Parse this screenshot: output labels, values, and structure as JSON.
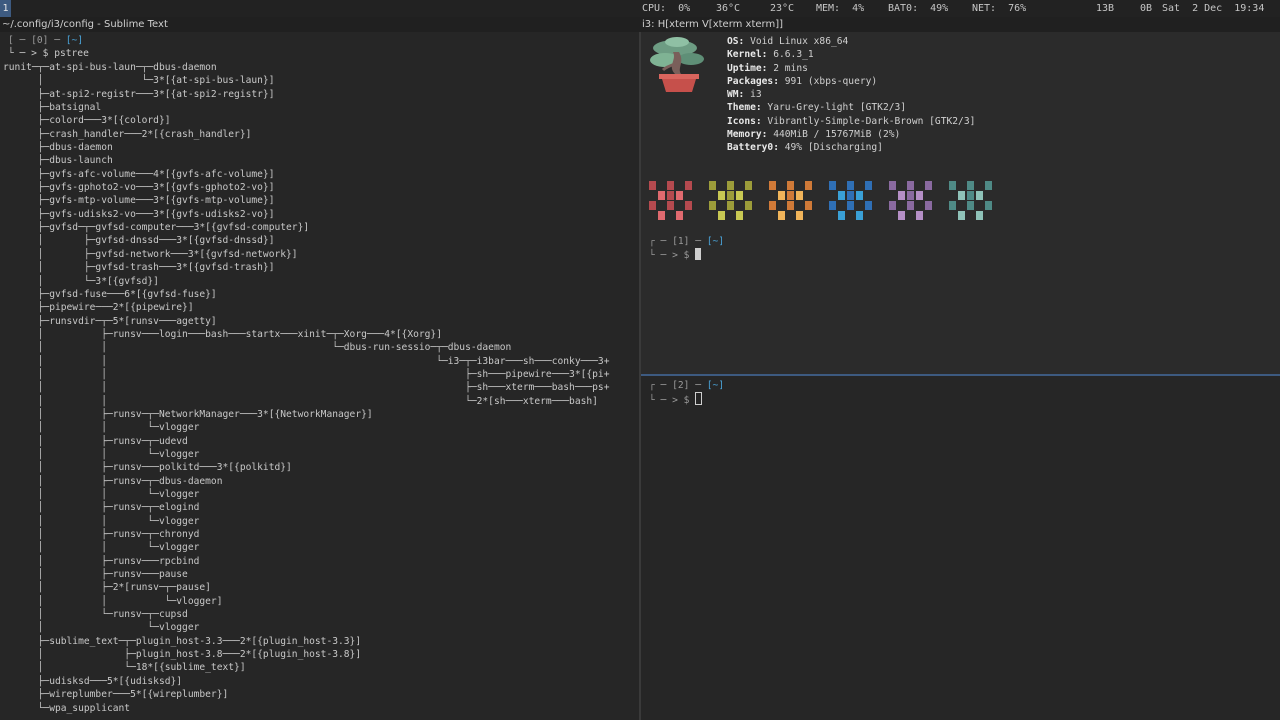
{
  "statusbar": {
    "workspace": "1",
    "items": [
      "CPU:  0%",
      "36°C",
      "23°C",
      "MEM:  4%",
      "BAT0:  49%",
      "NET:  76%",
      "13B",
      "0B",
      "Sat  2 Dec  19:34"
    ]
  },
  "left_window": {
    "title": "~/.config/i3/config - Sublime Text",
    "prompt_top": "[ ─ [0] ─ ",
    "prompt_dir": "[~]",
    "prompt_cmd": "└ ─ > $ pstree",
    "tree": [
      "runit─┬─at-spi-bus-laun─┬─dbus-daemon",
      "      │                 └─3*[{at-spi-bus-laun}]",
      "      ├─at-spi2-registr───3*[{at-spi2-registr}]",
      "      ├─batsignal",
      "      ├─colord───3*[{colord}]",
      "      ├─crash_handler───2*[{crash_handler}]",
      "      ├─dbus-daemon",
      "      ├─dbus-launch",
      "      ├─gvfs-afc-volume───4*[{gvfs-afc-volume}]",
      "      ├─gvfs-gphoto2-vo───3*[{gvfs-gphoto2-vo}]",
      "      ├─gvfs-mtp-volume───3*[{gvfs-mtp-volume}]",
      "      ├─gvfs-udisks2-vo───3*[{gvfs-udisks2-vo}]",
      "      ├─gvfsd─┬─gvfsd-computer───3*[{gvfsd-computer}]",
      "      │       ├─gvfsd-dnssd───3*[{gvfsd-dnssd}]",
      "      │       ├─gvfsd-network───3*[{gvfsd-network}]",
      "      │       ├─gvfsd-trash───3*[{gvfsd-trash}]",
      "      │       └─3*[{gvfsd}]",
      "      ├─gvfsd-fuse───6*[{gvfsd-fuse}]",
      "      ├─pipewire───2*[{pipewire}]",
      "      ├─runsvdir─┬─5*[runsv───agetty]",
      "      │          ├─runsv───login───bash───startx───xinit─┬─Xorg───4*[{Xorg}]",
      "      │          │                                       └─dbus-run-sessio─┬─dbus-daemon",
      "      │          │                                                         └─i3─┬─i3bar───sh───conky───3+",
      "      │          │                                                              ├─sh───pipewire───3*[{pi+",
      "      │          │                                                              ├─sh───xterm───bash───ps+",
      "      │          │                                                              └─2*[sh───xterm───bash]",
      "      │          ├─runsv─┬─NetworkManager───3*[{NetworkManager}]",
      "      │          │       └─vlogger",
      "      │          ├─runsv─┬─udevd",
      "      │          │       └─vlogger",
      "      │          ├─runsv───polkitd───3*[{polkitd}]",
      "      │          ├─runsv─┬─dbus-daemon",
      "      │          │       └─vlogger",
      "      │          ├─runsv─┬─elogind",
      "      │          │       └─vlogger",
      "      │          ├─runsv─┬─chronyd",
      "      │          │       └─vlogger",
      "      │          ├─runsv───rpcbind",
      "      │          ├─runsv───pause",
      "      │          ├─2*[runsv─┬─pause]",
      "      │          │          └─vlogger]",
      "      │          └─runsv─┬─cupsd",
      "      │                  └─vlogger",
      "      ├─sublime_text─┬─plugin_host-3.3───2*[{plugin_host-3.3}]",
      "      │              ├─plugin_host-3.8───2*[{plugin_host-3.8}]",
      "      │              └─18*[{sublime_text}]",
      "      ├─udisksd───5*[{udisksd}]",
      "      ├─wireplumber───5*[{wireplumber}]",
      "      └─wpa_supplicant"
    ]
  },
  "right_window": {
    "title": "i3: H[xterm V[xterm xterm]]",
    "neofetch": [
      {
        "key": "OS:",
        "value": " Void Linux x86_64"
      },
      {
        "key": "Kernel:",
        "value": " 6.6.3_1"
      },
      {
        "key": "Uptime:",
        "value": " 2 mins"
      },
      {
        "key": "Packages:",
        "value": " 991 (xbps-query)"
      },
      {
        "key": "WM:",
        "value": " i3"
      },
      {
        "key": "Theme:",
        "value": " Yaru-Grey-light [GTK2/3]"
      },
      {
        "key": "Icons:",
        "value": " Vibrantly-Simple-Dark-Brown [GTK2/3]"
      },
      {
        "key": "Memory:",
        "value": " 440MiB / 15767MiB (2%)"
      },
      {
        "key": "Battery0:",
        "value": " 49% [Discharging]"
      }
    ],
    "palette": [
      {
        "dark": "#b54a4f",
        "light": "#e06a6f"
      },
      {
        "dark": "#9c9c3a",
        "light": "#c8c853"
      },
      {
        "dark": "#d07a38",
        "light": "#f0b45a"
      },
      {
        "dark": "#2f6fb5",
        "light": "#3aa0d6"
      },
      {
        "dark": "#8a6aa0",
        "light": "#b58fc6"
      },
      {
        "dark": "#4f8a86",
        "light": "#8fc2b8"
      }
    ],
    "term1_prompt_top": "┌ ─ [1] ─ ",
    "term1_prompt_dir": "[~]",
    "term1_prompt_cmd": "└ ─ > $ ",
    "term2_prompt_top": "┌ ─ [2] ─ ",
    "term2_prompt_dir": "[~]",
    "term2_prompt_cmd": "└ ─ > $ "
  }
}
